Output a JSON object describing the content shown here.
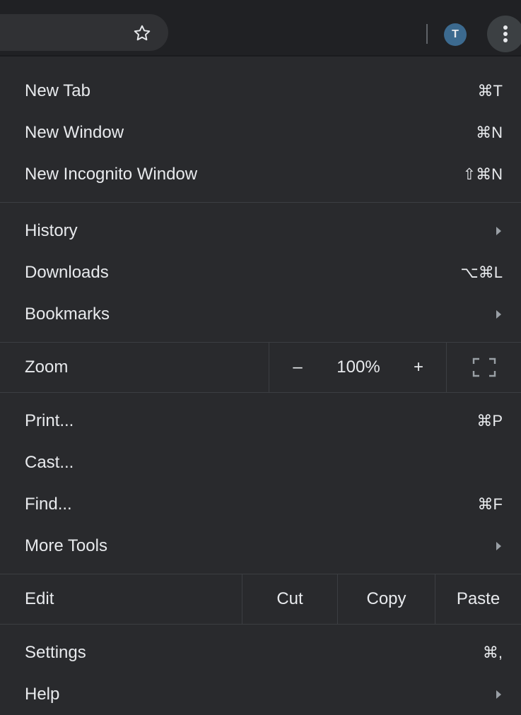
{
  "toolbar": {
    "avatar_letter": "T",
    "icons": [
      "star-icon",
      "kebab-menu-icon"
    ]
  },
  "menu": {
    "group1": [
      {
        "label": "New Tab",
        "shortcut": "⌘T"
      },
      {
        "label": "New Window",
        "shortcut": "⌘N"
      },
      {
        "label": "New Incognito Window",
        "shortcut": "⇧⌘N"
      }
    ],
    "group2": [
      {
        "label": "History",
        "submenu": true
      },
      {
        "label": "Downloads",
        "shortcut": "⌥⌘L"
      },
      {
        "label": "Bookmarks",
        "submenu": true
      }
    ],
    "zoom": {
      "label": "Zoom",
      "minus": "–",
      "value": "100%",
      "plus": "+"
    },
    "group3": [
      {
        "label": "Print...",
        "shortcut": "⌘P"
      },
      {
        "label": "Cast...",
        "shortcut": ""
      },
      {
        "label": "Find...",
        "shortcut": "⌘F"
      },
      {
        "label": "More Tools",
        "submenu": true
      }
    ],
    "edit": {
      "label": "Edit",
      "cut": "Cut",
      "copy": "Copy",
      "paste": "Paste"
    },
    "group4": [
      {
        "label": "Settings",
        "shortcut": "⌘,"
      },
      {
        "label": "Help",
        "submenu": true
      }
    ]
  },
  "colors": {
    "background": "#292a2d",
    "toolbar": "#202124",
    "text": "#e8eaed",
    "avatar": "#3c6a8f"
  }
}
